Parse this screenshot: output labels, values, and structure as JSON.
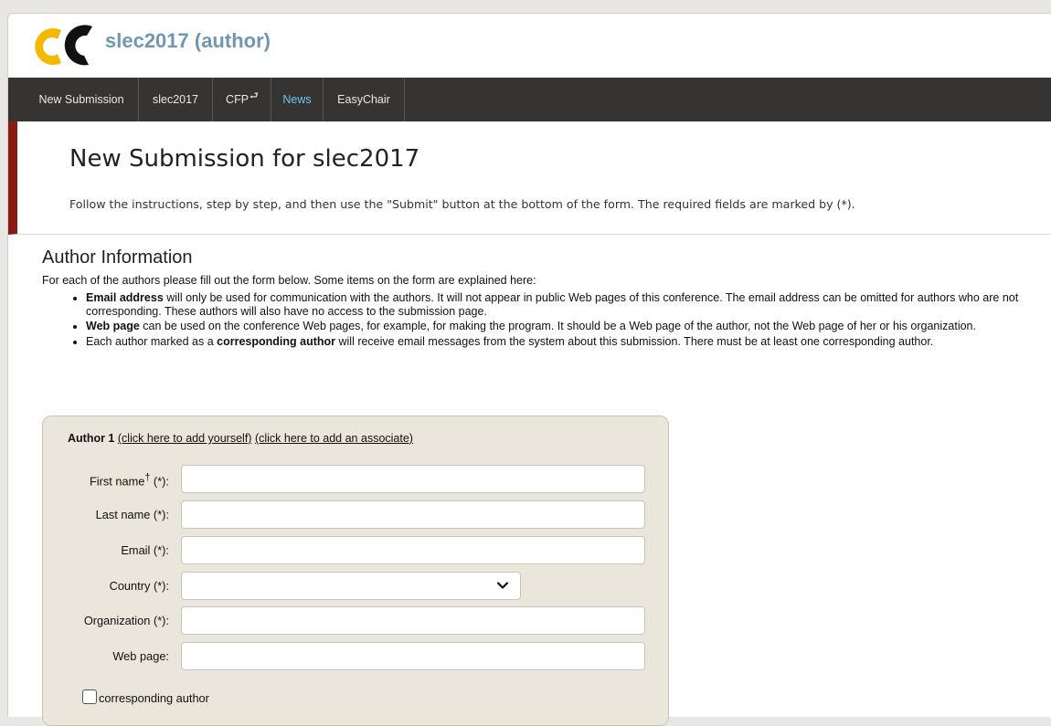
{
  "header": {
    "title": "slec2017 (author)",
    "logo_icon": "easychair-logo-icon",
    "colors": {
      "title": "#6f97b4",
      "logo_yellow": "#f5b800",
      "logo_black": "#111111"
    }
  },
  "nav": {
    "items": [
      {
        "label": "New Submission",
        "active": false
      },
      {
        "label": "slec2017",
        "active": false
      },
      {
        "label": "CFP",
        "active": false,
        "icon": "external-return-arrow-icon"
      },
      {
        "label": "News",
        "active": true
      },
      {
        "label": "EasyChair",
        "active": false
      }
    ],
    "colors": {
      "background": "#353432",
      "active_text": "#6fc8f0"
    }
  },
  "intro": {
    "title": "New Submission for slec2017",
    "text": "Follow the instructions, step by step, and then use the \"Submit\" button at the bottom of the form. The required fields are marked by (*).",
    "accent_color": "#8a1a14"
  },
  "author_info": {
    "title": "Author Information",
    "description": "For each of the authors please fill out the form below. Some items on the form are explained here:",
    "bullets": [
      {
        "bold": "Email address",
        "text": " will only be used for communication with the authors. It will not appear in public Web pages of this conference. The email address can be omitted for authors who are not corresponding. These authors will also have no access to the submission page."
      },
      {
        "bold": "Web page",
        "text": " can be used on the conference Web pages, for example, for making the program. It should be a Web page of the author, not the Web page of her or his organization."
      },
      {
        "prefix": "Each author marked as a ",
        "bold": "corresponding author",
        "text": " will receive email messages from the system about this submission. There must be at least one corresponding author."
      }
    ]
  },
  "author_form": {
    "heading": "Author 1",
    "add_yourself": "(click here to add yourself)",
    "add_associate": "(click here to add an associate)",
    "fields": {
      "first_name": {
        "label": "First name",
        "sup": "†",
        "req": " (*):",
        "value": ""
      },
      "last_name": {
        "label": "Last name (*):",
        "value": ""
      },
      "email": {
        "label": "Email (*):",
        "value": ""
      },
      "country": {
        "label": "Country (*):",
        "value": ""
      },
      "organization": {
        "label": "Organization (*):",
        "value": ""
      },
      "web_page": {
        "label": "Web page:",
        "value": ""
      }
    },
    "corresponding_label": "corresponding author",
    "corresponding_checked": false,
    "box_color": "#ebe6dc"
  }
}
